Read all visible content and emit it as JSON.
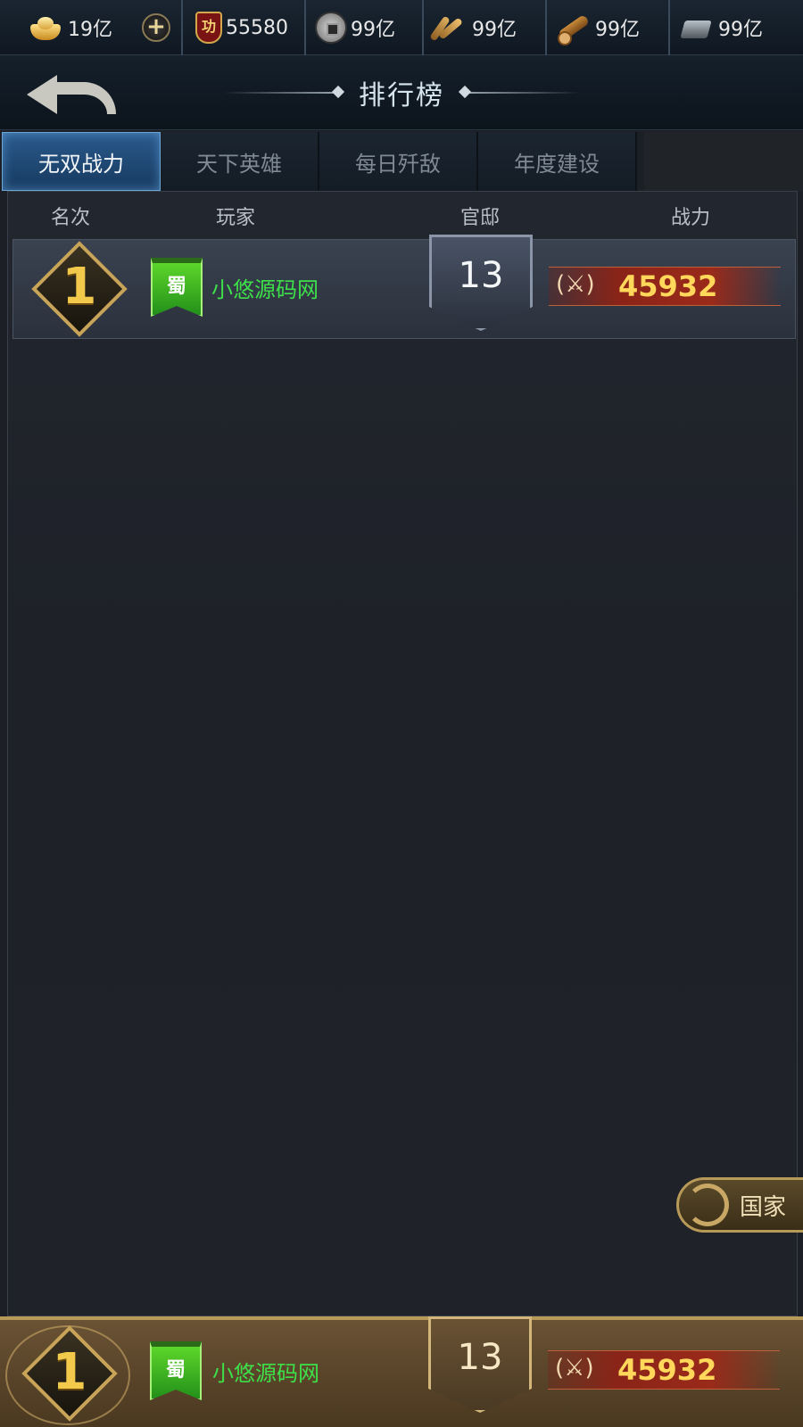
{
  "resources": [
    {
      "name": "gold-ingot",
      "value": "19亿",
      "icon": "gold-ingot-icon"
    },
    {
      "name": "merit",
      "value": "55580",
      "icon": "merit-badge-icon",
      "icon_text": "功"
    },
    {
      "name": "copper-coin",
      "value": "99亿",
      "icon": "copper-coin-icon"
    },
    {
      "name": "grain",
      "value": "99亿",
      "icon": "grain-icon"
    },
    {
      "name": "wood",
      "value": "99亿",
      "icon": "wood-icon"
    },
    {
      "name": "iron",
      "value": "99亿",
      "icon": "iron-icon"
    }
  ],
  "header": {
    "title": "排行榜",
    "back_icon": "back-arrow-icon"
  },
  "tabs": [
    {
      "label": "无双战力",
      "active": true
    },
    {
      "label": "天下英雄",
      "active": false
    },
    {
      "label": "每日歼敌",
      "active": false
    },
    {
      "label": "年度建设",
      "active": false
    }
  ],
  "columns": {
    "rank": "名次",
    "player": "玩家",
    "mansion": "官邸",
    "power": "战力"
  },
  "rows": [
    {
      "rank": "1",
      "faction": "蜀",
      "player": "小悠源码网",
      "mansion": "13",
      "power": "45932"
    }
  ],
  "self": {
    "rank": "1",
    "faction": "蜀",
    "player": "小悠源码网",
    "mansion": "13",
    "power": "45932"
  },
  "country_button": {
    "label": "国家",
    "icon": "cycle-icon"
  },
  "colors": {
    "accent_blue": "#2a5a8c",
    "name_green": "#3ee04a",
    "power_gold": "#ffd75a",
    "self_bar_brown": "#6a5234"
  }
}
